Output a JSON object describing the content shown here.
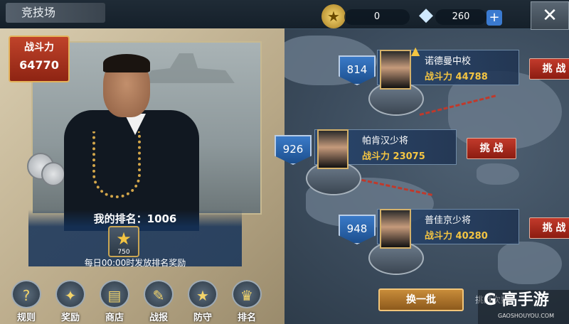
{
  "header": {
    "title": "竞技场",
    "medals": "0",
    "diamonds": "260",
    "plus_label": "+",
    "close_label": "✕"
  },
  "player": {
    "power_label": "战斗力",
    "power_value": "64770",
    "rank_text": "我的排名：1006",
    "rank_badge_number": "750",
    "reward_note": "每日00:00时发放排名奖励"
  },
  "menu": [
    {
      "label": "规则",
      "icon": "question-icon",
      "glyph": "?"
    },
    {
      "label": "奖励",
      "icon": "treasure-chest-icon",
      "glyph": "✦"
    },
    {
      "label": "商店",
      "icon": "gold-bars-icon",
      "glyph": "▤"
    },
    {
      "label": "战报",
      "icon": "clipboard-icon",
      "glyph": "✎"
    },
    {
      "label": "防守",
      "icon": "shield-icon",
      "glyph": "★"
    },
    {
      "label": "排名",
      "icon": "trophy-icon",
      "glyph": "♛"
    }
  ],
  "opponents": [
    {
      "rank": "814",
      "name": "诺德曼中校",
      "power": "战斗力 44788",
      "challenge": "挑 战"
    },
    {
      "rank": "926",
      "name": "帕肯汉少将",
      "power": "战斗力 23075",
      "challenge": "挑 战"
    },
    {
      "rank": "948",
      "name": "普佳京少将",
      "power": "战斗力 40280",
      "challenge": "挑 战"
    }
  ],
  "refresh_label": "换一批",
  "remaining_label": "挑战次数",
  "watermark": {
    "brand": "G 高手游",
    "url": "GAOSHOUYOU.COM"
  },
  "colors": {
    "accent_red": "#c23a2b",
    "gold": "#f4c542",
    "rank_blue": "#2a66b0"
  }
}
